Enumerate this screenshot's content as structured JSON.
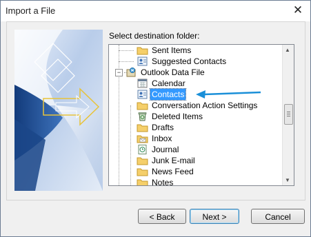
{
  "window": {
    "title": "Import a File",
    "close_glyph": "✕"
  },
  "main": {
    "folder_label": "Select destination folder:"
  },
  "tree": {
    "items": [
      {
        "label": "Sent Items",
        "icon": "folder-icon"
      },
      {
        "label": "Suggested Contacts",
        "icon": "contacts-icon"
      },
      {
        "label": "Outlook Data File",
        "icon": "data-file-icon"
      },
      {
        "label": "Calendar",
        "icon": "calendar-icon"
      },
      {
        "label": "Contacts",
        "icon": "contacts-icon",
        "selected": true
      },
      {
        "label": "Conversation Action Settings",
        "icon": "folder-icon"
      },
      {
        "label": "Deleted Items",
        "icon": "recycle-bin-icon"
      },
      {
        "label": "Drafts",
        "icon": "folder-icon"
      },
      {
        "label": "Inbox",
        "icon": "inbox-icon"
      },
      {
        "label": "Journal",
        "icon": "journal-icon"
      },
      {
        "label": "Junk E-mail",
        "icon": "folder-icon"
      },
      {
        "label": "News Feed",
        "icon": "folder-icon"
      },
      {
        "label": "Notes",
        "icon": "folder-icon"
      }
    ],
    "expander_glyph": "−"
  },
  "buttons": {
    "back": "< Back",
    "next": "Next >",
    "cancel": "Cancel"
  },
  "colors": {
    "selection": "#3399ff",
    "annotation_arrow": "#1a8fd8",
    "art_dark": "#1d4f99",
    "art_light": "#dce8f8"
  }
}
